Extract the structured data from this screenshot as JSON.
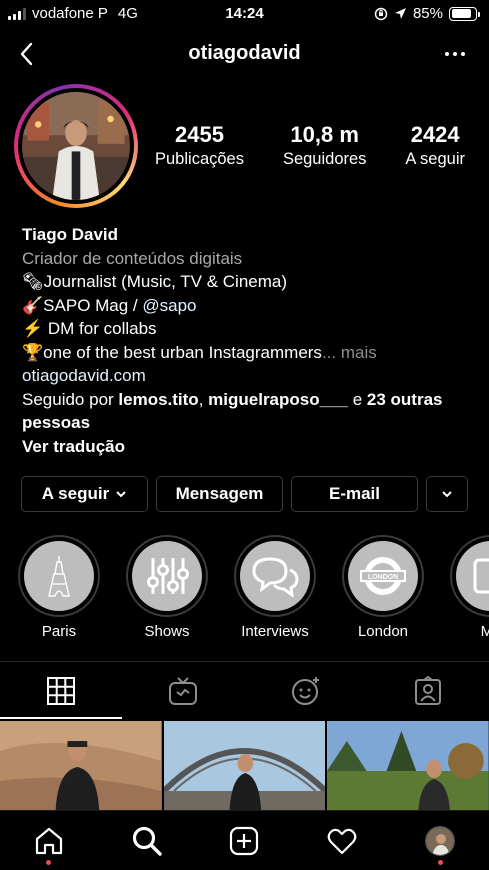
{
  "status_bar": {
    "carrier": "vodafone P",
    "network": "4G",
    "time": "14:24",
    "battery": "85%",
    "battery_level": 0.85
  },
  "header": {
    "username": "otiagodavid"
  },
  "stats": [
    {
      "value": "2455",
      "label": "Publicações"
    },
    {
      "value": "10,8 m",
      "label": "Seguidores"
    },
    {
      "value": "2424",
      "label": "A seguir"
    }
  ],
  "bio": {
    "name": "Tiago David",
    "category": "Criador de conteúdos digitais",
    "line1_emoji": "🗞",
    "line1": "Journalist (Music, TV & Cinema)",
    "line2_emoji": "🎸",
    "line2": "SAPO Mag / ",
    "line2_mention": "@sapo",
    "line3_emoji": "⚡",
    "line3": " DM for collabs",
    "line4_emoji": "🏆",
    "line4": "one of the best urban Instagrammers",
    "line4_ellipsis": "...",
    "more": "mais",
    "website": "otiagodavid.com",
    "followed_prefix": "Seguido por ",
    "followed_user1": "lemos.tito",
    "followed_sep": ", ",
    "followed_user2": "miguelraposo___",
    "followed_and": " e ",
    "followed_others": "23 outras pessoas",
    "translate": "Ver tradução"
  },
  "actions": {
    "follow": "A seguir",
    "message": "Mensagem",
    "email": "E-mail"
  },
  "highlights": [
    {
      "label": "Paris",
      "icon": "eiffel-tower-icon"
    },
    {
      "label": "Shows",
      "icon": "equalizer-sliders-icon"
    },
    {
      "label": "Interviews",
      "icon": "speech-bubbles-icon"
    },
    {
      "label": "London",
      "icon": "london-roundel-icon"
    },
    {
      "label": "Mu",
      "icon": "music-icon"
    }
  ],
  "tabs": [
    {
      "icon": "grid-icon",
      "active": true
    },
    {
      "icon": "igtv-icon",
      "active": false
    },
    {
      "icon": "effects-icon",
      "active": false
    },
    {
      "icon": "tagged-icon",
      "active": false
    }
  ],
  "bottom_nav": [
    {
      "icon": "home-icon"
    },
    {
      "icon": "search-icon"
    },
    {
      "icon": "new-post-icon"
    },
    {
      "icon": "activity-heart-icon"
    },
    {
      "icon": "profile-avatar-icon"
    }
  ],
  "colors": {
    "background": "#000000",
    "secondary_text": "#a8a8a8",
    "link": "#e0f1ff",
    "notification": "#ed4956",
    "border": "#3a3a3a"
  }
}
